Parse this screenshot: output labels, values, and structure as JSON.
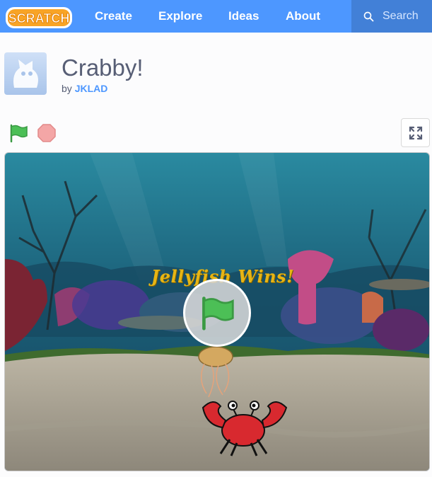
{
  "nav": {
    "logo_text": "SCRATCH",
    "links": [
      "Create",
      "Explore",
      "Ideas",
      "About"
    ],
    "search_placeholder": "Search"
  },
  "project": {
    "title": "Crabby!",
    "by_label": "by",
    "author": "JKLAD"
  },
  "stage": {
    "overlay_text": "Jellyfish Wins!"
  },
  "colors": {
    "nav_bg": "#4d97ff",
    "link": "#4d97ff",
    "title_text": "#575e75",
    "flag_green": "#4cbf56",
    "stop_red": "#ec5959"
  },
  "icons": [
    "scratch-logo",
    "search-icon",
    "green-flag-icon",
    "stop-icon",
    "fullscreen-icon",
    "avatar-cat-icon",
    "play-flag-icon"
  ]
}
